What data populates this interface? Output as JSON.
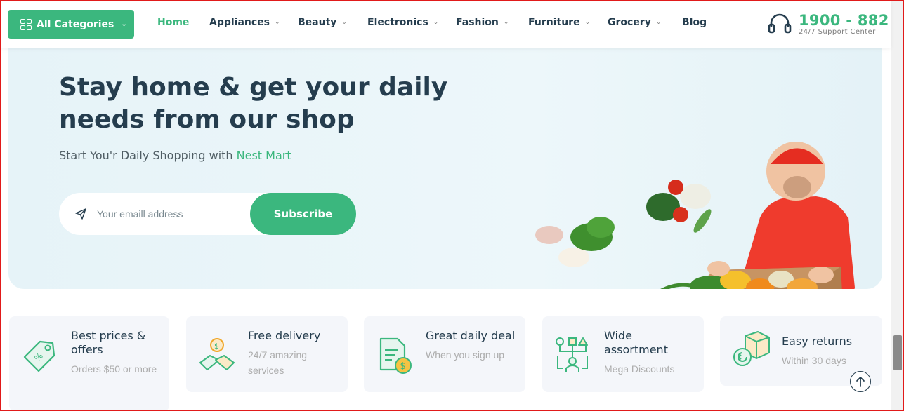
{
  "nav": {
    "categories_label": "All Categories",
    "items": [
      {
        "label": "Home",
        "dropdown": false
      },
      {
        "label": "Appliances",
        "dropdown": true
      },
      {
        "label": "Beauty",
        "dropdown": true
      },
      {
        "label": "Electronics",
        "dropdown": true
      },
      {
        "label": "Fashion",
        "dropdown": true
      },
      {
        "label": "Furniture",
        "dropdown": true
      },
      {
        "label": "Grocery",
        "dropdown": true
      },
      {
        "label": "Blog",
        "dropdown": false
      }
    ],
    "support_number": "1900 - 882",
    "support_text": "24/7 Support Center"
  },
  "hero": {
    "title": "Stay home & get your daily needs from our shop",
    "subtitle_prefix": "Start You'r Daily Shopping with ",
    "subtitle_brand": "Nest Mart",
    "email_placeholder": "Your emaill address",
    "subscribe_label": "Subscribe"
  },
  "features": [
    {
      "title": "Best prices & offers",
      "desc": "Orders $50 or more",
      "icon": "price-tag-icon"
    },
    {
      "title": "Free delivery",
      "desc": "24/7 amazing services",
      "icon": "delivery-icon"
    },
    {
      "title": "Great daily deal",
      "desc": "When you sign up",
      "icon": "deal-icon"
    },
    {
      "title": "Wide assortment",
      "desc": "Mega Discounts",
      "icon": "assortment-icon"
    },
    {
      "title": "Easy returns",
      "desc": "Within 30 days",
      "icon": "returns-icon"
    }
  ],
  "colors": {
    "brand": "#3bb77e",
    "heading": "#253d4e",
    "muted": "#adadad",
    "hero_bg": "#e6f3f8"
  }
}
